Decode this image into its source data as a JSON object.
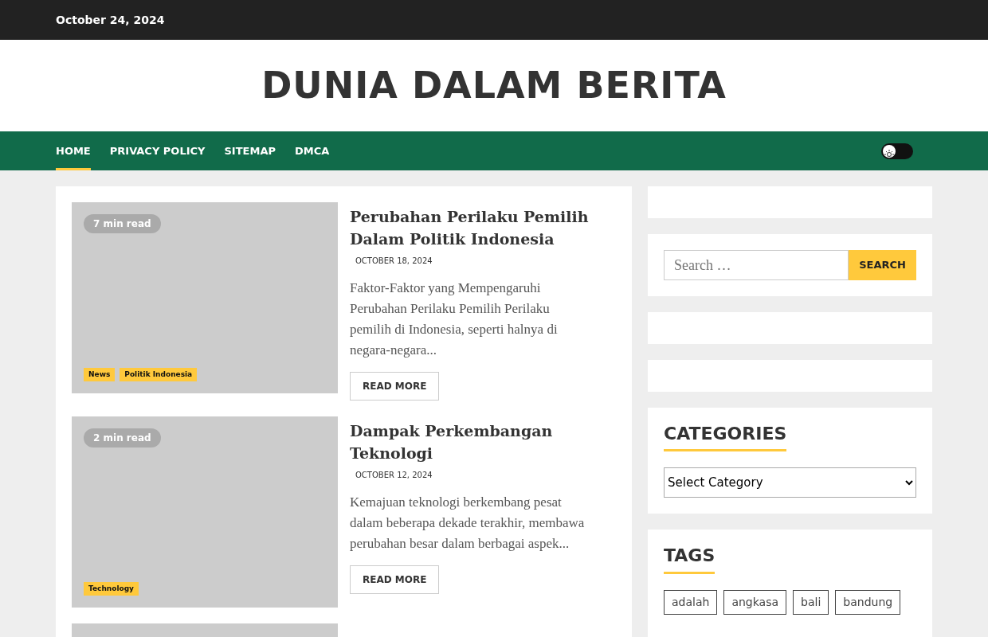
{
  "top_bar": {
    "date": "October 24, 2024"
  },
  "site_title": "DUNIA DALAM BERITA",
  "nav": {
    "items": [
      {
        "label": "HOME",
        "selected": true
      },
      {
        "label": "PRIVACY POLICY",
        "selected": false
      },
      {
        "label": "SITEMAP",
        "selected": false
      },
      {
        "label": "DMCA",
        "selected": false
      }
    ],
    "theme_toggle": {
      "on": false
    }
  },
  "articles": [
    {
      "read_time": "7 min read",
      "categories": [
        "News",
        "Politik Indonesia"
      ],
      "title": "Perubahan Perilaku Pemilih Dalam Politik Indonesia",
      "date": "OCTOBER 18, 2024",
      "excerpt": "Faktor-Faktor yang Mempengaruhi Perubahan Perilaku Pemilih Perilaku pemilih di Indonesia, seperti halnya di negara-negara...",
      "button": "READ MORE"
    },
    {
      "read_time": "2 min read",
      "categories": [
        "Technology"
      ],
      "title": "Dampak Perkembangan Teknologi",
      "date": "OCTOBER 12, 2024",
      "excerpt": "Kemajuan teknologi berkembang pesat dalam beberapa dekade terakhir, membawa perubahan besar dalam berbagai aspek...",
      "button": "READ MORE"
    }
  ],
  "sidebar": {
    "search": {
      "placeholder": "Search …",
      "button": "SEARCH"
    },
    "categories": {
      "heading": "CATEGORIES",
      "select": "Select Category"
    },
    "tags": {
      "heading": "TAGS",
      "items": [
        "adalah",
        "angkasa",
        "bali",
        "bandung"
      ]
    }
  }
}
